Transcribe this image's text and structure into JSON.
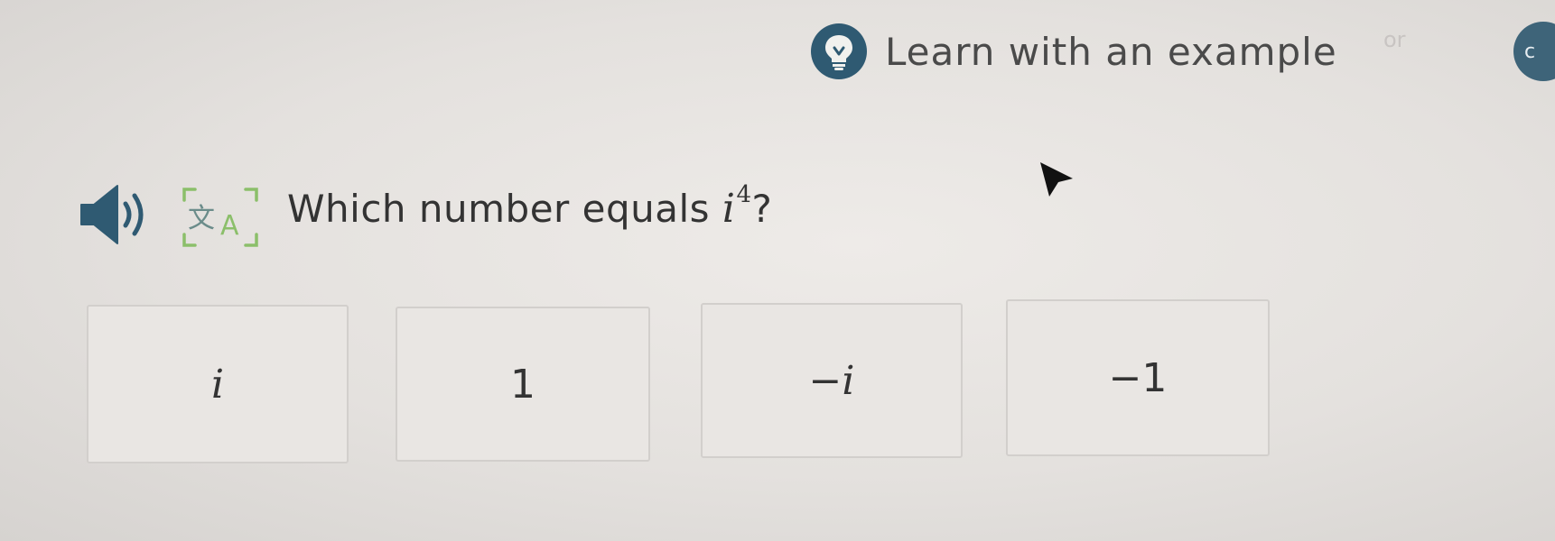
{
  "header": {
    "learn_label": "Learn with an example",
    "learn_icon": "lightbulb-icon",
    "faded_text": "or",
    "edge_button_text": "c"
  },
  "question": {
    "prefix": "Which number equals ",
    "variable": "i",
    "exponent": "4",
    "suffix": "?",
    "audio_icon": "speaker-icon",
    "translate_icon": "translate-icon"
  },
  "choices": [
    {
      "label": "i"
    },
    {
      "label": "1"
    },
    {
      "label": "−i"
    },
    {
      "label": "−1"
    }
  ],
  "colors": {
    "accent": "#2f5a72",
    "text": "#333333",
    "translate_icon": "#8bbf6a",
    "choice_border": "#d2cfcc"
  }
}
